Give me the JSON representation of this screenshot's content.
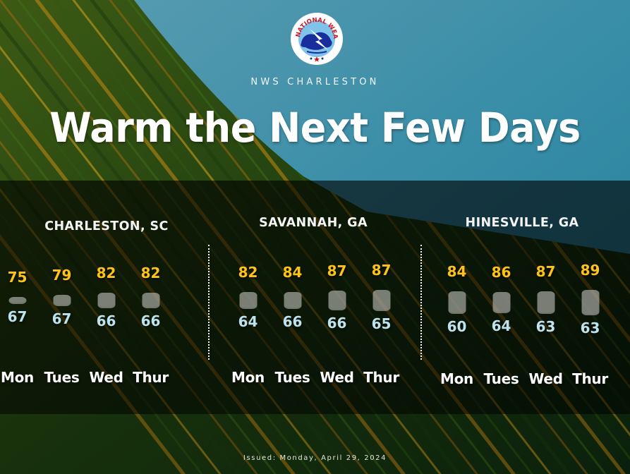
{
  "header": {
    "logo_icon": "nws-logo-icon",
    "logo_text": "NATIONAL WEATHER SERVICE",
    "office": "NWS CHARLESTON",
    "headline": "Warm the Next Few Days"
  },
  "footer": {
    "issued": "Issued: Monday, April 29, 2024"
  },
  "colors": {
    "high_temp": "#ffc317",
    "low_temp": "#bde3ee",
    "sky": "#2f87a3",
    "band": "#000000"
  },
  "chart_data": {
    "type": "range-bar",
    "title": "Warm the Next Few Days",
    "units": "°F",
    "days": [
      "Mon",
      "Tues",
      "Wed",
      "Thur"
    ],
    "locations": [
      {
        "name": "CHARLESTON, SC",
        "high": [
          75,
          79,
          82,
          82
        ],
        "low": [
          67,
          67,
          66,
          66
        ]
      },
      {
        "name": "SAVANNAH, GA",
        "high": [
          82,
          84,
          87,
          87
        ],
        "low": [
          64,
          66,
          66,
          65
        ]
      },
      {
        "name": "HINESVILLE, GA",
        "high": [
          84,
          86,
          87,
          89
        ],
        "low": [
          60,
          64,
          63,
          63
        ]
      }
    ]
  }
}
